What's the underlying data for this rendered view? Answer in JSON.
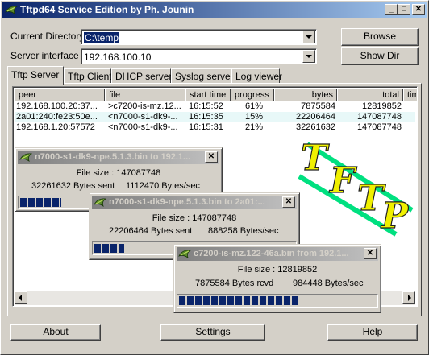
{
  "window": {
    "title": "Tftpd64 Service Edition by Ph. Jounin"
  },
  "titlebar_buttons": {
    "minimize": "_",
    "maximize": "□",
    "close": "✕"
  },
  "form": {
    "current_directory_label": "Current Directory",
    "current_directory_value": "C:\\temp",
    "server_interface_label": "Server interface",
    "server_interface_value": "192.168.100.10",
    "browse_label": "Browse",
    "show_dir_label": "Show Dir"
  },
  "tabs": [
    {
      "label": "Tftp Server",
      "active": true
    },
    {
      "label": "Tftp Client"
    },
    {
      "label": "DHCP server"
    },
    {
      "label": "Syslog server"
    },
    {
      "label": "Log viewer"
    }
  ],
  "table": {
    "columns": [
      "peer",
      "file",
      "start time",
      "progress",
      "bytes",
      "total",
      "tim"
    ],
    "rows": [
      {
        "peer": "192.168.100.20:37...",
        "file": ">c7200-is-mz.12...",
        "start": "16:15:52",
        "progress": "61%",
        "bytes": "7875584",
        "total": "12819852"
      },
      {
        "peer": "2a01:240:fe23:50e...",
        "file": "<n7000-s1-dk9-...",
        "start": "16:15:35",
        "progress": "15%",
        "bytes": "22206464",
        "total": "147087748"
      },
      {
        "peer": "192.168.1.20:57572",
        "file": "<n7000-s1-dk9-...",
        "start": "16:15:31",
        "progress": "21%",
        "bytes": "32261632",
        "total": "147087748"
      }
    ]
  },
  "dialogs": [
    {
      "title": "n7000-s1-dk9-npe.5.1.3.bin to 192.1...",
      "file_size": "File size : 147087748",
      "bytes_text": "32261632 Bytes sent",
      "rate_text": "1112470 Bytes/sec",
      "progress": 0.21,
      "close": "✕"
    },
    {
      "title": "n7000-s1-dk9-npe.5.1.3.bin to 2a01:...",
      "file_size": "File size : 147087748",
      "bytes_text": "22206464 Bytes sent",
      "rate_text": "888258 Bytes/sec",
      "progress": 0.15,
      "close": "✕"
    },
    {
      "title": "c7200-is-mz.122-46a.bin from 192.1...",
      "file_size": "File size : 12819852",
      "bytes_text": "7875584 Bytes rcvd",
      "rate_text": "984448 Bytes/sec",
      "progress": 0.61,
      "close": "✕"
    }
  ],
  "logo": {
    "letters": [
      "T",
      "F",
      "T",
      "P"
    ],
    "letter_color": "#f0f000",
    "bar_color": "#00e080"
  },
  "footer": {
    "about_label": "About",
    "settings_label": "Settings",
    "help_label": "Help"
  },
  "colors": {
    "active_title": "#0a246a",
    "inactive_title": "#808080",
    "face": "#d4d0c8",
    "progress_block": "#0a246a"
  }
}
